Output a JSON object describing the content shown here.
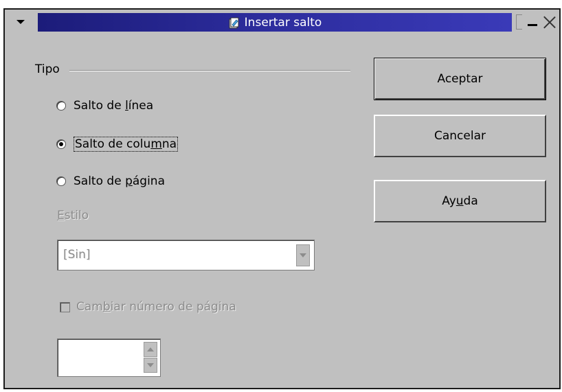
{
  "window": {
    "title": "Insertar salto"
  },
  "type_group": {
    "title": "Tipo",
    "options": [
      {
        "label_pre": "Salto de ",
        "mnemonic": "l",
        "label_post": "ínea",
        "selected": false
      },
      {
        "label_pre": "Salto de colu",
        "mnemonic": "m",
        "label_post": "na",
        "selected": true
      },
      {
        "label_pre": "Salto de ",
        "mnemonic": "p",
        "label_post": "ágina",
        "selected": false
      }
    ]
  },
  "style": {
    "label_mnemonic": "E",
    "label_rest": "stilo",
    "value": "[Sin]",
    "enabled": false
  },
  "change_page_number": {
    "label_pre": "Cam",
    "mnemonic": "b",
    "label_post": "iar número de página",
    "checked": false,
    "enabled": false
  },
  "page_number": {
    "value": ""
  },
  "buttons": {
    "ok": "Aceptar",
    "cancel": "Cancelar",
    "help_pre": "Ay",
    "help_mnemonic": "u",
    "help_post": "da"
  },
  "colors": {
    "dialog_bg": "#c0c0c0",
    "title_bar": "#2d2d9e",
    "disabled_text": "#8c8c8c"
  }
}
